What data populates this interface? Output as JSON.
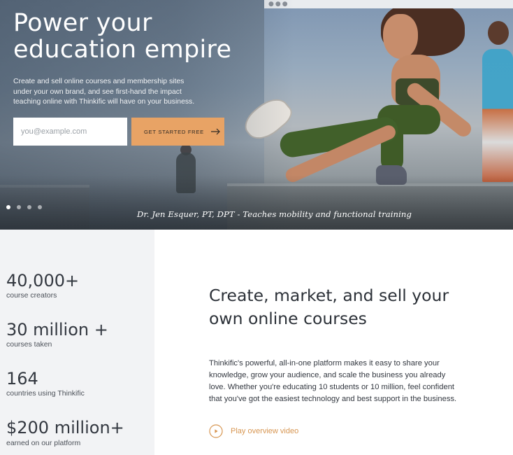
{
  "hero": {
    "title": "Power your education empire",
    "subtitle": "Create and sell online courses and membership sites under your own brand, and see first-hand the impact teaching online with Thinkific will have on your business.",
    "email_placeholder": "you@example.com",
    "email_value": "",
    "cta_label": "GET STARTED FREE",
    "cta_icon": "arrow-right-icon",
    "cta_color": "#e8a365",
    "caption": "Dr. Jen Esquer, PT, DPT - Teaches mobility and functional training",
    "slides": [
      {
        "active": true
      },
      {
        "active": false
      },
      {
        "active": false
      },
      {
        "active": false
      }
    ]
  },
  "stats": [
    {
      "value": "40,000+",
      "label": "course creators"
    },
    {
      "value": "30 million +",
      "label": "courses taken"
    },
    {
      "value": "164",
      "label": "countries using Thinkific"
    },
    {
      "value": "$200 million+",
      "label": "earned on our platform"
    }
  ],
  "feature": {
    "title": "Create, market, and sell your own online courses",
    "body": "Thinkific's powerful, all-in-one platform makes it easy to share your knowledge, grow your audience, and scale the business you already love. Whether you're educating 10 students or 10 million, feel confident that you've got the easiest technology and best support in the business.",
    "video_label": "Play overview video",
    "video_icon": "play-circle-icon",
    "accent_color": "#d79652"
  }
}
